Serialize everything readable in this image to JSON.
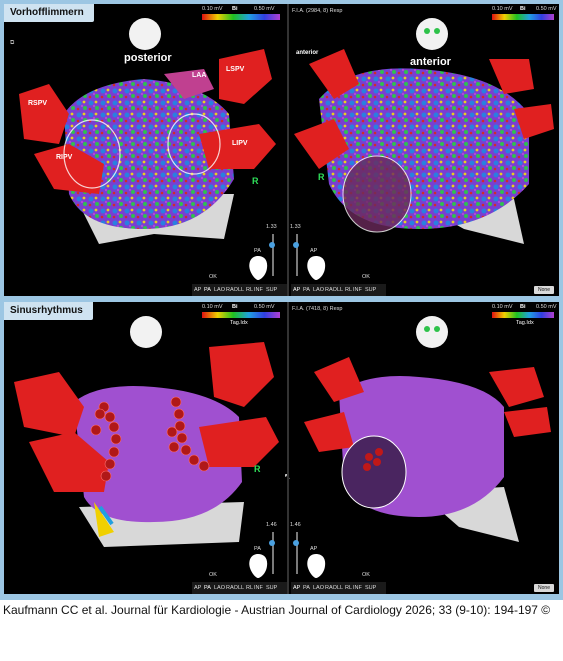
{
  "panels": {
    "top": {
      "tab": "Vorhofflimmern",
      "left_view": "posterior",
      "right_view": "anterior",
      "veins": [
        "RSPV",
        "RIPV",
        "LSPV",
        "LIPV",
        "LAA"
      ],
      "right_anterior_label": "anterior",
      "r_label": "R",
      "scale_min": "0.10 mV",
      "scale_mode": "Bi",
      "scale_max": "0.50 mV",
      "right_header": "F.I.A. (2984, 8) Resp",
      "slider_value_left": "1.33",
      "slider_value_right": "1.33",
      "orient_left": "PA",
      "orient_right": "AP",
      "toolbar_items": [
        "AP",
        "PA",
        "LAO",
        "RAO",
        "LL",
        "RL",
        "INF",
        "SUP"
      ],
      "ok": "OK",
      "none": "None"
    },
    "bottom": {
      "tab": "Sinusrhythmus",
      "scale_min": "0.10 mV",
      "scale_mode": "Bi",
      "scale_max": "0.50 mV",
      "tag_label": "Tag.Idx",
      "right_header": "F.I.A. (7418, 8) Resp",
      "slider_value_left": "1.46",
      "slider_value_right": "1.46",
      "orient_left": "PA",
      "orient_right": "AP",
      "r_label": "R",
      "toolbar_items": [
        "AP",
        "PA",
        "LAO",
        "RAO",
        "LL",
        "RL",
        "INF",
        "SUP"
      ],
      "ok": "OK",
      "none": "None"
    }
  },
  "caption": "Kaufmann CC et al. Journal für Kardiologie - Austrian Journal of Cardiology 2026; 33 (9-10): 194-197 ©"
}
